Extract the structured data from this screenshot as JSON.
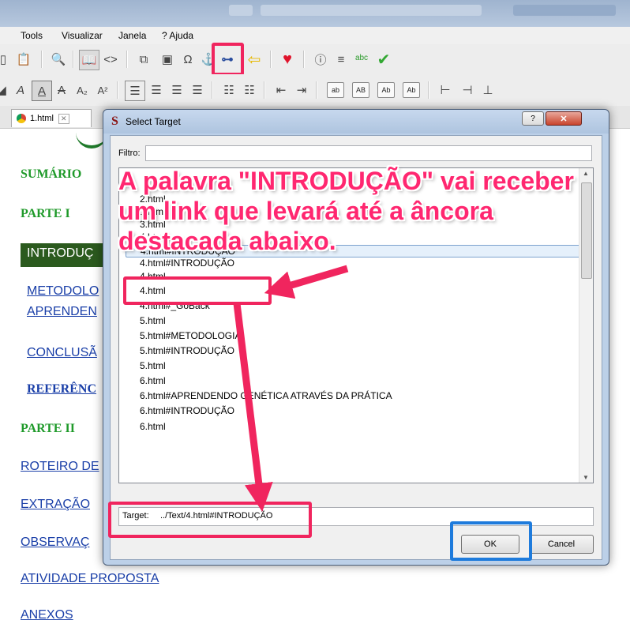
{
  "menu": {
    "items": [
      "Tools",
      "Visualizar",
      "Janela",
      "? Ajuda"
    ]
  },
  "toolbar2_buttons": [
    "ab",
    "AB",
    "Ab",
    "Ab"
  ],
  "tabs": [
    {
      "label": "1.html"
    }
  ],
  "document": {
    "headings": [
      "SUMÁRIO",
      "PARTE I",
      "PARTE II"
    ],
    "introducao": "INTRODUÇ",
    "metodologia": "METODOLO",
    "aprendendo": "APRENDEN",
    "conclusao": "CONCLUSÃ",
    "referencias": "REFERÊNC",
    "roteiro": "ROTEIRO DE",
    "extracao": "EXTRAÇÃO",
    "observacao": "OBSERVAÇ",
    "atividade": "ATIVIDADE PROPOSTA",
    "anexos": "ANEXOS"
  },
  "dialog": {
    "title": "Select Target",
    "help": "?",
    "close": "✕",
    "filter_label": "Filtro:",
    "items": [
      "2.html",
      "1.html",
      "3.html",
      "4.html",
      "4.html#INTRODUÇÃO",
      "4.html#INTRODUÇÃO",
      "4.html",
      "4.html",
      "4.html#_GoBack",
      "5.html",
      "5.html#METODOLOGIA",
      "5.html#INTRODUÇÃO",
      "5.html",
      "6.html",
      "6.html#APRENDENDO GENÉTICA ATRAVÉS DA PRÁTICA",
      "6.html#INTRODUÇÃO",
      "6.html"
    ],
    "selected_index": 4,
    "target_label": "Target:",
    "target_value": "../Text/4.html#INTRODUÇÃO",
    "ok_label": "OK",
    "cancel_label": "Cancel"
  },
  "annotation": {
    "text": "A palavra \"INTRODUÇÃO\" vai receber um link que levará até a âncora destacada abaixo."
  },
  "colors": {
    "highlight": "#f0255e",
    "ok_highlight": "#1e7bdc",
    "annotation": "#ff2770",
    "doc_heading": "#1f9a2a",
    "doc_link": "#1a3fa8"
  }
}
